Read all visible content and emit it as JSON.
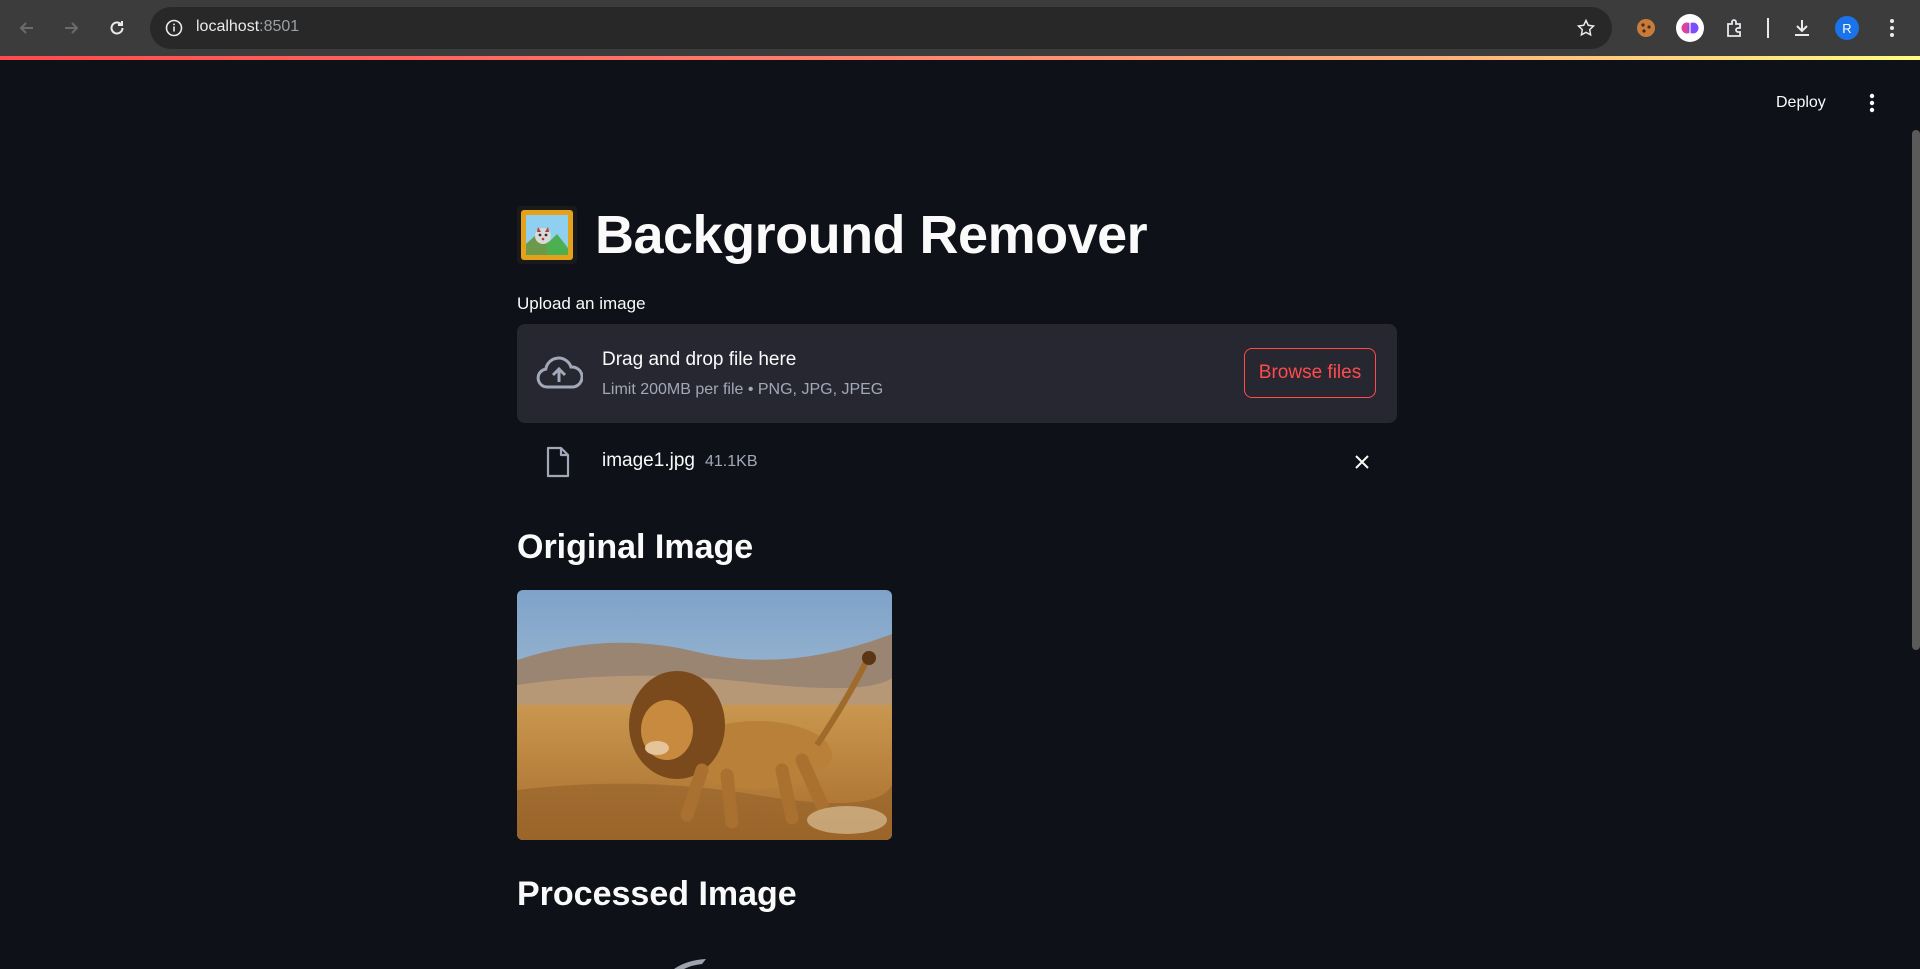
{
  "browser": {
    "url_host": "localhost",
    "url_port": ":8501",
    "avatar_letter": "R"
  },
  "header": {
    "deploy_label": "Deploy"
  },
  "app": {
    "title": "Background Remover",
    "uploader": {
      "label": "Upload an image",
      "drop_text": "Drag and drop file here",
      "limit_text": "Limit 200MB per file • PNG, JPG, JPEG",
      "browse_label": "Browse files"
    },
    "file": {
      "name": "image1.jpg",
      "size": "41.1KB"
    },
    "original_heading": "Original Image",
    "processed_heading": "Processed Image"
  },
  "colors": {
    "background": "#0e1117",
    "panel": "#262730",
    "accent": "#ff4b4b",
    "muted_text": "#a3a8b8"
  }
}
